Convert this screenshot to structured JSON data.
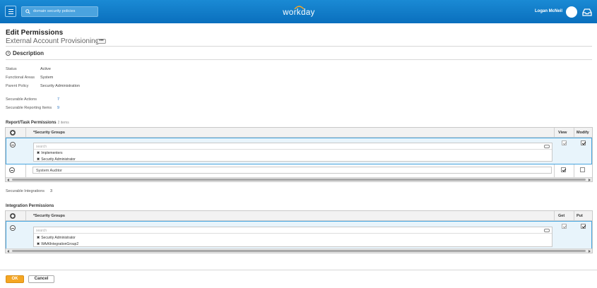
{
  "header": {
    "search_value": "domain security policies",
    "logo_text": "workday",
    "user_name": "Logan McNeil"
  },
  "page": {
    "title": "Edit Permissions",
    "subtitle": "External Account Provisioning",
    "more_label": "•••"
  },
  "description": {
    "heading": "Description",
    "fields": [
      {
        "label": "Status",
        "value": "Active"
      },
      {
        "label": "Functional Areas",
        "value": "System"
      },
      {
        "label": "Parent Policy",
        "value": "Security Administration"
      }
    ],
    "securable_actions_label": "Securable Actions",
    "securable_actions_value": "7",
    "securable_reporting_label": "Securable Reporting Items",
    "securable_reporting_value": "9"
  },
  "report_task": {
    "title": "Report/Task Permissions",
    "count": "2 items",
    "col_groups": "*Security Groups",
    "col_view": "View",
    "col_modify": "Modify",
    "rows": [
      {
        "search_placeholder": "search",
        "groups": [
          "Implementers",
          "Security Administrator"
        ],
        "view": true,
        "modify": true
      },
      {
        "group": "System Auditor",
        "view": true,
        "modify": false
      }
    ]
  },
  "integrations": {
    "label": "Securable Integrations",
    "value": "3"
  },
  "integration_permissions": {
    "title": "Integration Permissions",
    "col_groups": "*Security Groups",
    "col_get": "Get",
    "col_put": "Put",
    "rows": [
      {
        "search_placeholder": "search",
        "groups": [
          "Security Administrator",
          "WAAIIntegrationGroup2"
        ],
        "get": true,
        "put": true
      }
    ]
  },
  "footer": {
    "ok_label": "OK",
    "cancel_label": "Cancel"
  },
  "colors": {
    "header_blue": "#0a6fbd",
    "selected_row": "#e8f4fb",
    "ok_orange": "#f5a623",
    "link_blue": "#2a74c4"
  }
}
